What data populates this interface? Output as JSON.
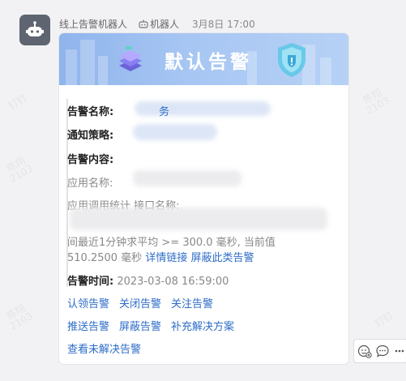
{
  "watermarks": [
    {
      "line1": "陈翔",
      "line2": "2103"
    },
    {
      "line1": "钉钉",
      "line2": ""
    }
  ],
  "header": {
    "sender": "线上告警机器人",
    "tag": "机器人",
    "time": "3月8日 17:00"
  },
  "card": {
    "banner_title": "默认告警",
    "fields": {
      "name_label": "告警名称:",
      "name_value_partial": "务",
      "policy_label": "通知策略:",
      "content_label": "告警内容:",
      "app_label": "应用名称:",
      "stat_label": "应用调用统计 接口名称:",
      "desc_line1": "间最近1分钟求平均 >= 300.0 毫秒, 当前值",
      "desc_line2_value": "510.2500 毫秒",
      "detail_link": "详情链接",
      "mask_link": "屏蔽此类告警",
      "time_label": "告警时间:",
      "time_value": "2023-03-08 16:59:00"
    },
    "actions": {
      "row1": [
        "认领告警",
        "关闭告警",
        "关注告警"
      ],
      "row2": [
        "推送告警",
        "屏蔽告警",
        "补充解决方案"
      ],
      "row3": [
        "查看未解决告警"
      ]
    }
  },
  "colors": {
    "link": "#2e6cc7",
    "banner": "#a7c6f3"
  }
}
